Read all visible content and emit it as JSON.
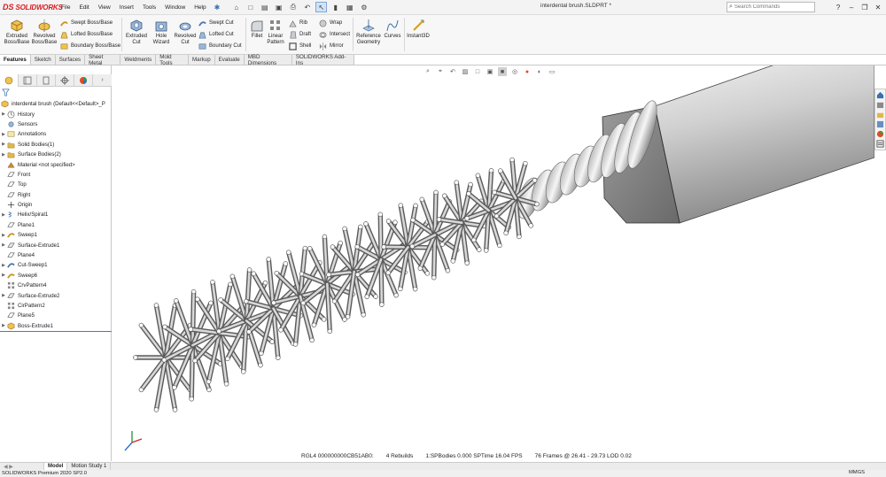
{
  "app": {
    "brand": "SOLIDWORKS",
    "document_title": "interdental brush.SLDPRT *",
    "menus": [
      "File",
      "Edit",
      "View",
      "Insert",
      "Tools",
      "Window",
      "Help"
    ],
    "search_placeholder": "Search Commands"
  },
  "ribbon": {
    "extruded_boss": "Extruded Boss/Base",
    "revolved_boss": "Revolved Boss/Base",
    "swept_boss": "Swept Boss/Base",
    "lofted_boss": "Lofted Boss/Base",
    "boundary_boss": "Boundary Boss/Base",
    "extruded_cut": "Extruded Cut",
    "hole_wizard": "Hole Wizard",
    "revolved_cut": "Revolved Cut",
    "swept_cut": "Swept Cut",
    "lofted_cut": "Lofted Cut",
    "boundary_cut": "Boundary Cut",
    "fillet": "Fillet",
    "linear_pattern": "Linear Pattern",
    "rib": "Rib",
    "draft": "Draft",
    "shell": "Shell",
    "wrap": "Wrap",
    "intersect": "Intersect",
    "mirror": "Mirror",
    "reference_geometry": "Reference Geometry",
    "curves": "Curves",
    "instant3d": "Instant3D"
  },
  "tabs": [
    "Features",
    "Sketch",
    "Surfaces",
    "Sheet Metal",
    "Weldments",
    "Mold Tools",
    "Markup",
    "Evaluate",
    "MBD Dimensions",
    "SOLIDWORKS Add-Ins"
  ],
  "tree": {
    "root": "interdental brush  (Default<<Default>_P",
    "items": [
      {
        "label": "History",
        "arrow": true,
        "icon": "history"
      },
      {
        "label": "Sensors",
        "arrow": false,
        "icon": "sensor"
      },
      {
        "label": "Annotations",
        "arrow": true,
        "icon": "annot"
      },
      {
        "label": "Solid Bodies(1)",
        "arrow": true,
        "icon": "folder"
      },
      {
        "label": "Surface Bodies(2)",
        "arrow": true,
        "icon": "folder"
      },
      {
        "label": "Material <not specified>",
        "arrow": false,
        "icon": "material"
      },
      {
        "label": "Front",
        "arrow": false,
        "icon": "plane"
      },
      {
        "label": "Top",
        "arrow": false,
        "icon": "plane"
      },
      {
        "label": "Right",
        "arrow": false,
        "icon": "plane"
      },
      {
        "label": "Origin",
        "arrow": false,
        "icon": "origin"
      },
      {
        "label": "Helix/Spiral1",
        "arrow": true,
        "icon": "helix"
      },
      {
        "label": "Plane1",
        "arrow": false,
        "icon": "plane"
      },
      {
        "label": "Sweep1",
        "arrow": true,
        "icon": "sweep"
      },
      {
        "label": "Surface-Extrude1",
        "arrow": true,
        "icon": "surface"
      },
      {
        "label": "Plane4",
        "arrow": false,
        "icon": "plane"
      },
      {
        "label": "Cut-Sweep1",
        "arrow": true,
        "icon": "cut"
      },
      {
        "label": "Sweep6",
        "arrow": true,
        "icon": "sweep"
      },
      {
        "label": "CrvPattern4",
        "arrow": false,
        "icon": "pattern"
      },
      {
        "label": "Surface-Extrude2",
        "arrow": true,
        "icon": "surface"
      },
      {
        "label": "CirPattern2",
        "arrow": false,
        "icon": "pattern"
      },
      {
        "label": "Plane5",
        "arrow": false,
        "icon": "plane"
      },
      {
        "label": "Boss-Extrude1",
        "arrow": true,
        "icon": "boss"
      }
    ]
  },
  "status": {
    "rgl": "RGL4 000000000CB51AB0:",
    "rebuilds": "4 Rebuilds",
    "bodies": "1:SPBodies  0.000 SPTime  16.04 FPS",
    "frames": "76 Frames @  26.41 -  29.73 LOD 0.02"
  },
  "bottom_tabs": [
    "Model",
    "Motion Study 1"
  ],
  "statusbar": {
    "product": "SOLIDWORKS Premium 2020 SP2.0",
    "units": "MMGS"
  },
  "colors": {
    "brand_red": "#d71d23",
    "accent_blue": "#3a7bd5"
  }
}
